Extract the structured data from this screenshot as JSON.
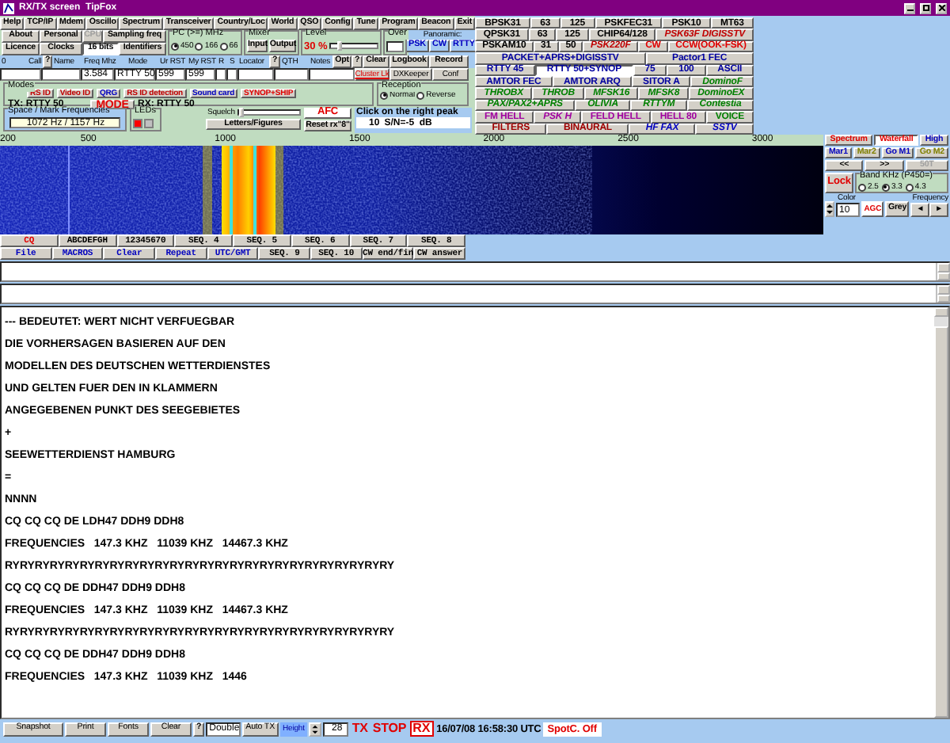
{
  "window": {
    "title": "RX/TX screen  TipFox"
  },
  "menu": [
    "Help",
    "TCP/IP",
    "Mdem",
    "Oscillo",
    "Spectrum",
    "Transceiver",
    "Country/Loc",
    "World",
    "QSO",
    "Config",
    "Tune",
    "Program",
    "Beacon",
    "Exit"
  ],
  "settings_buttons": [
    {
      "label": "About",
      "selected": false,
      "disabled": false
    },
    {
      "label": "Personal",
      "selected": false,
      "disabled": false
    },
    {
      "label": "CPU",
      "selected": false,
      "disabled": true
    },
    {
      "label": "Sampling freq",
      "selected": false,
      "disabled": false
    },
    {
      "label": "Licence",
      "selected": false,
      "disabled": false
    },
    {
      "label": "Clocks",
      "selected": false,
      "disabled": false
    },
    {
      "label": "16 bits",
      "selected": true,
      "disabled": false
    },
    {
      "label": "Identifiers",
      "selected": false,
      "disabled": false
    }
  ],
  "pc_speed": {
    "legend": "PC (>=) MHz",
    "options": [
      {
        "label": "450",
        "selected": true
      },
      {
        "label": "166",
        "selected": false
      },
      {
        "label": "66",
        "selected": false
      }
    ]
  },
  "mixer": {
    "legend": "Mixer",
    "buttons": [
      "Input",
      "Output"
    ]
  },
  "level": {
    "legend": "Level",
    "reading": "30 %",
    "level": 0.15
  },
  "over": {
    "legend": "Over"
  },
  "panoramic": {
    "label": "Panoramic:",
    "buttons": [
      "PSK",
      "CW",
      "RTTY"
    ]
  },
  "log": {
    "header": [
      {
        "kind": "label",
        "text": "0"
      },
      {
        "kind": "label",
        "text": "Call"
      },
      {
        "kind": "button",
        "text": "?"
      },
      {
        "kind": "label",
        "text": "Name"
      },
      {
        "kind": "label",
        "text": "Freq Mhz"
      },
      {
        "kind": "label",
        "text": "Mode"
      },
      {
        "kind": "label",
        "text": "Ur RST"
      },
      {
        "kind": "label",
        "text": "My RST"
      },
      {
        "kind": "label",
        "text": "R"
      },
      {
        "kind": "label",
        "text": "S"
      },
      {
        "kind": "label",
        "text": "Locator"
      },
      {
        "kind": "button",
        "text": "?"
      },
      {
        "kind": "label",
        "text": "QTH"
      },
      {
        "kind": "label",
        "text": "Notes"
      },
      {
        "kind": "button",
        "text": "Opt"
      },
      {
        "kind": "button",
        "text": "?"
      },
      {
        "kind": "button",
        "text": "Clear"
      },
      {
        "kind": "button",
        "text": "Logbook"
      },
      {
        "kind": "button",
        "text": "Record"
      }
    ],
    "values": [
      {
        "kind": "field"
      },
      {
        "kind": "field"
      },
      {
        "kind": "field",
        "value": "3.584"
      },
      {
        "kind": "field",
        "value": "RTTY 50"
      },
      {
        "kind": "field",
        "value": "599"
      },
      {
        "kind": "field",
        "value": "599"
      },
      {
        "kind": "field"
      },
      {
        "kind": "field"
      },
      {
        "kind": "field"
      },
      {
        "kind": "field"
      },
      {
        "kind": "field"
      },
      {
        "kind": "link",
        "text": "Cluster Lk"
      },
      {
        "kind": "button",
        "text": "DXKeeper"
      },
      {
        "kind": "button",
        "text": "Conf"
      }
    ]
  },
  "modes": {
    "legend": "Modes",
    "buttons": [
      {
        "label": "RS ID",
        "color": "#c00000"
      },
      {
        "label": "Video ID",
        "color": "#c00000"
      },
      {
        "label": "QRG",
        "color": "#0000c0"
      },
      {
        "label": "RS ID detection",
        "color": "#c00000"
      },
      {
        "label": "Sound card",
        "color": "#0000c0"
      },
      {
        "label": "SYNOP+SHIP",
        "color": "#e00000"
      }
    ],
    "tx": "TX: RTTY 50",
    "mode_button": "MODE",
    "rx": "RX: RTTY 50"
  },
  "reception": {
    "legend": "Reception",
    "options": [
      {
        "label": "Normal",
        "selected": true
      },
      {
        "label": "Reverse",
        "selected": false
      }
    ]
  },
  "space_mark": {
    "legend": "Space / Mark Frequencies",
    "value": "1072 Hz / 1157 Hz"
  },
  "leds": {
    "legend": "LEDs",
    "items": [
      {
        "on": true
      },
      {
        "on": false
      }
    ]
  },
  "squelch": {
    "label": "Squelch",
    "level": 0,
    "button": "Letters/Figures"
  },
  "afc": {
    "label": "AFC",
    "reset": "Reset rx\"8\""
  },
  "peak": {
    "label": "Click on the right peak",
    "value": "10",
    "snr": "S/N=-5  dB"
  },
  "mode_grid": [
    [
      {
        "label": "BPSK31",
        "color": "#000000",
        "italic": false,
        "selected": false
      },
      {
        "label": "63",
        "color": "#000000",
        "italic": false,
        "selected": false
      },
      {
        "label": "125",
        "color": "#000000",
        "italic": false,
        "selected": false
      },
      {
        "label": "PSKFEC31",
        "color": "#000000",
        "italic": false,
        "selected": false
      },
      {
        "label": "PSK10",
        "color": "#000000",
        "italic": false,
        "selected": false
      },
      {
        "label": "MT63",
        "color": "#000000",
        "italic": false,
        "selected": false
      }
    ],
    [
      {
        "label": "QPSK31",
        "color": "#000000",
        "italic": false,
        "selected": false
      },
      {
        "label": "63",
        "color": "#000000",
        "italic": false,
        "selected": false
      },
      {
        "label": "125",
        "color": "#000000",
        "italic": false,
        "selected": false
      },
      {
        "label": "CHIP64/128",
        "color": "#000000",
        "italic": false,
        "selected": false
      },
      {
        "label": "PSK63F DIGISSTV",
        "color": "#c00000",
        "italic": true,
        "selected": false
      }
    ],
    [
      {
        "label": "PSKAM10",
        "color": "#000000",
        "italic": false,
        "selected": false
      },
      {
        "label": "31",
        "color": "#000000",
        "italic": false,
        "selected": false
      },
      {
        "label": "50",
        "color": "#000000",
        "italic": false,
        "selected": false
      },
      {
        "label": "PSK220F",
        "color": "#c00000",
        "italic": true,
        "selected": false
      },
      {
        "label": "CW",
        "color": "#e00000",
        "italic": false,
        "selected": false
      },
      {
        "label": "CCW(OOK-FSK)",
        "color": "#e00000",
        "italic": false,
        "selected": false
      }
    ],
    [
      {
        "label": "PACKET+APRS+DIGISSTV",
        "color": "#0000a0",
        "italic": false,
        "selected": false
      },
      {
        "label": "Pactor1 FEC",
        "color": "#0000a0",
        "italic": false,
        "selected": false
      }
    ],
    [
      {
        "label": "RTTY 45",
        "color": "#0000a0",
        "italic": false,
        "selected": false
      },
      {
        "label": "RTTY 50+SYNOP",
        "color": "#0000a0",
        "italic": false,
        "selected": true
      },
      {
        "label": "75",
        "color": "#0000a0",
        "italic": false,
        "selected": false
      },
      {
        "label": "100",
        "color": "#0000a0",
        "italic": false,
        "selected": false
      },
      {
        "label": "ASCII",
        "color": "#0000a0",
        "italic": false,
        "selected": false
      }
    ],
    [
      {
        "label": "AMTOR FEC",
        "color": "#0000a0",
        "italic": false,
        "selected": false
      },
      {
        "label": "AMTOR ARQ",
        "color": "#0000a0",
        "italic": false,
        "selected": false
      },
      {
        "label": "SITOR A",
        "color": "#0000a0",
        "italic": false,
        "selected": false
      },
      {
        "label": "DominoF",
        "color": "#008000",
        "italic": true,
        "selected": false
      }
    ],
    [
      {
        "label": "THROBX",
        "color": "#008000",
        "italic": true,
        "selected": false
      },
      {
        "label": "THROB",
        "color": "#008000",
        "italic": true,
        "selected": false
      },
      {
        "label": "MFSK16",
        "color": "#008000",
        "italic": true,
        "selected": false
      },
      {
        "label": "MFSK8",
        "color": "#008000",
        "italic": true,
        "selected": false
      },
      {
        "label": "DominoEX",
        "color": "#008000",
        "italic": true,
        "selected": false
      }
    ],
    [
      {
        "label": "PAX/PAX2+APRS",
        "color": "#008000",
        "italic": true,
        "selected": false
      },
      {
        "label": "OLIVIA",
        "color": "#008000",
        "italic": true,
        "selected": false
      },
      {
        "label": "RTTYM",
        "color": "#008000",
        "italic": true,
        "selected": false
      },
      {
        "label": "Contestia",
        "color": "#008000",
        "italic": true,
        "selected": false
      }
    ],
    [
      {
        "label": "FM HELL",
        "color": "#a000a0",
        "italic": false,
        "selected": false
      },
      {
        "label": "PSK H",
        "color": "#a000a0",
        "italic": true,
        "selected": false
      },
      {
        "label": "FELD HELL",
        "color": "#a000a0",
        "italic": false,
        "selected": false
      },
      {
        "label": "HELL 80",
        "color": "#a000a0",
        "italic": false,
        "selected": false
      },
      {
        "label": "VOICE",
        "color": "#008000",
        "italic": false,
        "selected": false
      }
    ],
    [
      {
        "label": "FILTERS",
        "color": "#a00000",
        "italic": false,
        "selected": false
      },
      {
        "label": "BINAURAL",
        "color": "#a00000",
        "italic": false,
        "selected": false
      },
      {
        "label": "HF FAX",
        "color": "#0000c0",
        "italic": true,
        "selected": false
      },
      {
        "label": "SSTV",
        "color": "#0000c0",
        "italic": true,
        "selected": false
      }
    ]
  ],
  "frequency_scale": [
    "200",
    "500",
    "1000",
    "1500",
    "2000",
    "2500",
    "3000"
  ],
  "display_controls": {
    "views": [
      {
        "label": "Spectrum",
        "selected": false
      },
      {
        "label": "Waterfall",
        "selected": true
      },
      {
        "label": "High",
        "selected": false
      }
    ],
    "markers": [
      {
        "label": "Mar1",
        "color": "#0000c0"
      },
      {
        "label": "Mar2",
        "color": "#808000"
      },
      {
        "label": "Go M1",
        "color": "#0000c0"
      },
      {
        "label": "Go M2",
        "color": "#808000"
      }
    ],
    "scroll": [
      {
        "label": "<<",
        "disabled": false
      },
      {
        "label": ">>",
        "disabled": false
      },
      {
        "label": "50T",
        "disabled": true
      }
    ],
    "lock": "Lock",
    "band": {
      "legend": "Band KHz (P450=)",
      "options": [
        {
          "label": "2.5",
          "selected": false
        },
        {
          "label": "3.3",
          "selected": true
        },
        {
          "label": "4.3",
          "selected": false
        }
      ]
    },
    "color": {
      "label": "Color",
      "value": "10"
    },
    "agc": "AGC",
    "grey": "Grey",
    "frequency": {
      "label": "Frequency",
      "buttons": [
        "◄",
        "►"
      ]
    }
  },
  "macros": [
    [
      {
        "label": "CQ",
        "color": "#e00000"
      },
      {
        "label": "ABCDEFGH",
        "color": "#000000"
      },
      {
        "label": "12345670",
        "color": "#000000"
      },
      {
        "label": "SEQ. 4",
        "color": "#000000"
      },
      {
        "label": "SEQ. 5",
        "color": "#000000"
      },
      {
        "label": "SEQ. 6",
        "color": "#000000"
      },
      {
        "label": "SEQ. 7",
        "color": "#000000"
      },
      {
        "label": "SEQ. 8",
        "color": "#000000"
      }
    ],
    [
      {
        "label": "File",
        "color": "#0000c0"
      },
      {
        "label": "MACROS",
        "color": "#0000c0"
      },
      {
        "label": "Clear",
        "color": "#0000c0"
      },
      {
        "label": "Repeat",
        "color": "#0000c0"
      },
      {
        "label": "UTC/GMT",
        "color": "#0000c0"
      },
      {
        "label": "SEQ. 9",
        "color": "#000000"
      },
      {
        "label": "SEQ. 10",
        "color": "#000000"
      },
      {
        "label": "CW end/fin",
        "color": "#000000"
      },
      {
        "label": "CW answer",
        "color": "#000000"
      }
    ]
  ],
  "rx_text": [
    "--- BEDEUTET: WERT NICHT VERFUEGBAR",
    "DIE VORHERSAGEN BASIEREN AUF DEN",
    "MODELLEN DES DEUTSCHEN WETTERDIENSTES",
    "UND GELTEN FUER DEN IN KLAMMERN",
    "ANGEGEBENEN PUNKT DES SEEGEBIETES",
    "+",
    "SEEWETTERDIENST HAMBURG",
    "=",
    "NNNN",
    "CQ CQ CQ DE LDH47 DDH9 DDH8",
    "FREQUENCIES   147.3 KHZ   11039 KHZ   14467.3 KHZ",
    "RYRYRYRYRYRYRYRYRYRYRYRYRYRYRYRYRYRYRYRYRYRYRYRYRYRY",
    "CQ CQ CQ DE DDH47 DDH9 DDH8",
    "FREQUENCIES   147.3 KHZ   11039 KHZ   14467.3 KHZ",
    "RYRYRYRYRYRYRYRYRYRYRYRYRYRYRYRYRYRYRYRYRYRYRYRYRYRY",
    "CQ CQ CQ DE DDH47 DDH9 DDH8",
    "FREQUENCIES   147.3 KHZ   11039 KHZ   1446"
  ],
  "status_bar": {
    "buttons": [
      "Snapshot",
      "Print",
      "Fonts",
      "Clear"
    ],
    "help": "?",
    "double": "Double",
    "auto_tx": "Auto TX",
    "height_label": "Height",
    "height_value": "28",
    "tx": "TX",
    "stop": "STOP",
    "rx": {
      "label": "RX",
      "selected": true
    },
    "time": "16/07/08 16:58:30 UTC",
    "spot": "SpotC. Off"
  }
}
